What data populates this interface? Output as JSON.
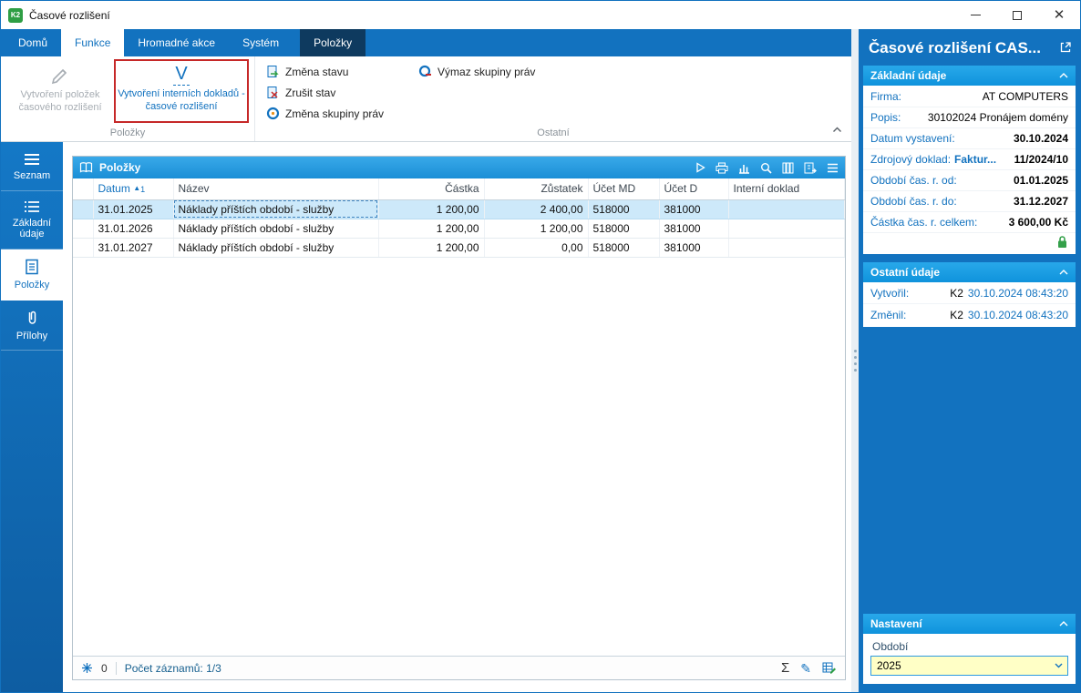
{
  "window": {
    "title": "Časové rozlišení"
  },
  "tabs": [
    {
      "label": "Domů"
    },
    {
      "label": "Funkce"
    },
    {
      "label": "Hromadné akce"
    },
    {
      "label": "Systém"
    },
    {
      "label": "Položky"
    }
  ],
  "ribbon": {
    "group_items": {
      "label": "Položky",
      "disabled_button": "Vytvoření položek časového rozlišení",
      "main_button_glyph": "V",
      "main_button": "Vytvoření interních dokladů - časové rozlišení"
    },
    "group_other": {
      "label": "Ostatní",
      "buttons": [
        {
          "label": "Změna stavu"
        },
        {
          "label": "Zrušit stav"
        },
        {
          "label": "Změna skupiny práv"
        },
        {
          "label": "Výmaz skupiny práv"
        }
      ]
    }
  },
  "sidebar": {
    "items": [
      {
        "label": "Seznam"
      },
      {
        "label": "Základní údaje"
      },
      {
        "label": "Položky"
      },
      {
        "label": "Přílohy"
      }
    ]
  },
  "grid": {
    "title": "Položky",
    "columns": {
      "datum": "Datum",
      "nazev": "Název",
      "castka": "Částka",
      "zustatek": "Zůstatek",
      "ucet_md": "Účet MD",
      "ucet_d": "Účet D",
      "interni": "Interní doklad"
    },
    "sort_mark": "▲",
    "sort_num": "1",
    "rows": [
      {
        "datum": "31.01.2025",
        "nazev": "Náklady příštích období - služby",
        "castka": "1 200,00",
        "zustatek": "2 400,00",
        "ucet_md": "518000",
        "ucet_d": "381000",
        "interni": ""
      },
      {
        "datum": "31.01.2026",
        "nazev": "Náklady příštích období - služby",
        "castka": "1 200,00",
        "zustatek": "1 200,00",
        "ucet_md": "518000",
        "ucet_d": "381000",
        "interni": ""
      },
      {
        "datum": "31.01.2027",
        "nazev": "Náklady příštích období - služby",
        "castka": "1 200,00",
        "zustatek": "0,00",
        "ucet_md": "518000",
        "ucet_d": "381000",
        "interni": ""
      }
    ],
    "footer": {
      "counter": "0",
      "records": "Počet záznamů: 1/3"
    }
  },
  "detail": {
    "title": "Časové rozlišení CAS...",
    "basic": {
      "header": "Základní údaje",
      "rows": [
        {
          "label": "Firma:",
          "value": "AT COMPUTERS"
        },
        {
          "label": "Popis:",
          "value": "30102024 Pronájem domény"
        },
        {
          "label": "Datum vystavení:",
          "value": "30.10.2024"
        },
        {
          "label": "Zdrojový doklad:",
          "link": "Faktur...",
          "value": "11/2024/10"
        },
        {
          "label": "Období čas. r. od:",
          "value": "01.01.2025"
        },
        {
          "label": "Období čas. r. do:",
          "value": "31.12.2027"
        },
        {
          "label": "Částka čas. r. celkem:",
          "value": "3 600,00 Kč"
        }
      ]
    },
    "other": {
      "header": "Ostatní údaje",
      "rows": [
        {
          "label": "Vytvořil:",
          "user": "K2",
          "timestamp": "30.10.2024 08:43:20"
        },
        {
          "label": "Změnil:",
          "user": "K2",
          "timestamp": "30.10.2024 08:43:20"
        }
      ]
    },
    "settings": {
      "header": "Nastavení",
      "field_label": "Období",
      "field_value": "2025"
    }
  }
}
